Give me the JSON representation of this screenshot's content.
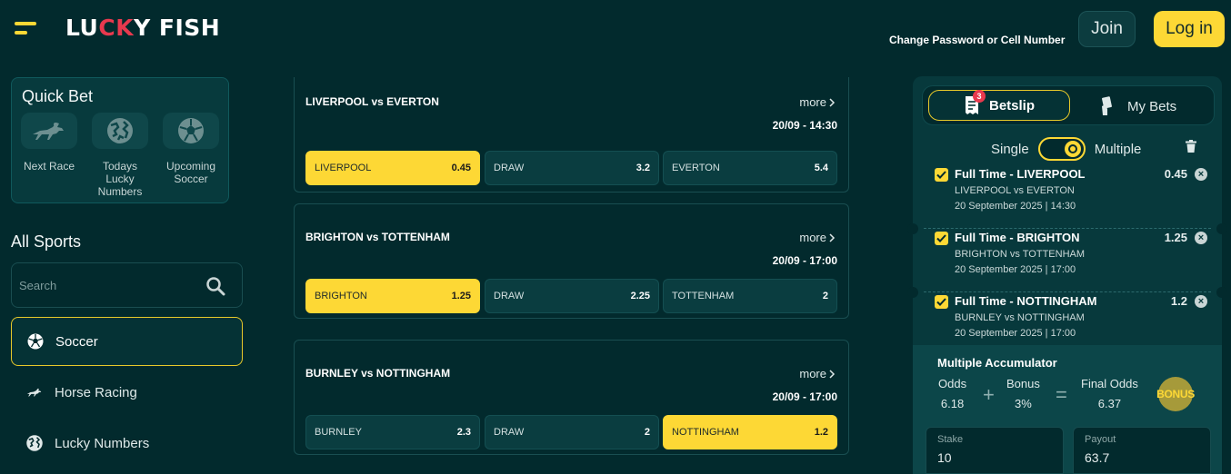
{
  "header": {
    "logo_text_a": "LU",
    "logo_text_b": "CK",
    "logo_text_c": "Y FISH",
    "change_password": "Change Password or Cell Number",
    "join": "Join",
    "login": "Log in"
  },
  "quick_bet": {
    "title": "Quick Bet",
    "items": [
      {
        "label": "Next Race",
        "icon": "horse-racing-icon"
      },
      {
        "label": "Todays Lucky Numbers",
        "icon": "globe-icon"
      },
      {
        "label": "Upcoming Soccer",
        "icon": "soccer-ball-icon"
      }
    ]
  },
  "sports": {
    "title": "All Sports",
    "search_placeholder": "Search",
    "items": [
      {
        "label": "Soccer",
        "icon": "soccer-ball-icon",
        "active": true
      },
      {
        "label": "Horse Racing",
        "icon": "horse-racing-icon"
      },
      {
        "label": "Lucky Numbers",
        "icon": "globe-icon"
      }
    ]
  },
  "matches": [
    {
      "title": "LIVERPOOL vs EVERTON",
      "more": "more",
      "datetime": "20/09 - 14:30",
      "odds": [
        {
          "label": "LIVERPOOL",
          "value": "0.45",
          "selected": true
        },
        {
          "label": "DRAW",
          "value": "3.2"
        },
        {
          "label": "EVERTON",
          "value": "5.4"
        }
      ]
    },
    {
      "title": "BRIGHTON vs TOTTENHAM",
      "more": "more",
      "datetime": "20/09 - 17:00",
      "odds": [
        {
          "label": "BRIGHTON",
          "value": "1.25",
          "selected": true
        },
        {
          "label": "DRAW",
          "value": "2.25"
        },
        {
          "label": "TOTTENHAM",
          "value": "2"
        }
      ]
    },
    {
      "title": "BURNLEY vs NOTTINGHAM",
      "more": "more",
      "datetime": "20/09 - 17:00",
      "odds": [
        {
          "label": "BURNLEY",
          "value": "2.3"
        },
        {
          "label": "DRAW",
          "value": "2"
        },
        {
          "label": "NOTTINGHAM",
          "value": "1.2",
          "selected": true
        }
      ]
    }
  ],
  "betslip": {
    "tab_betslip": "Betslip",
    "badge": "3",
    "tab_mybets": "My Bets",
    "single": "Single",
    "multiple": "Multiple",
    "bets": [
      {
        "title": "Full Time - LIVERPOOL",
        "match": "LIVERPOOL vs EVERTON",
        "date": "20 September 2025 | 14:30",
        "odd": "0.45"
      },
      {
        "title": "Full Time - BRIGHTON",
        "match": "BRIGHTON vs TOTTENHAM",
        "date": "20 September 2025 | 17:00",
        "odd": "1.25"
      },
      {
        "title": "Full Time - NOTTINGHAM",
        "match": "BURNLEY vs NOTTINGHAM",
        "date": "20 September 2025 | 17:00",
        "odd": "1.2"
      }
    ],
    "accumulator": {
      "title": "Multiple Accumulator",
      "odds_label": "Odds",
      "odds_value": "6.18",
      "bonus_label": "Bonus",
      "bonus_value": "3%",
      "final_label": "Final Odds",
      "final_value": "6.37",
      "bonus_badge": "BONUS",
      "plus": "+",
      "equals": "="
    },
    "stake_label": "Stake",
    "stake_value": "10",
    "payout_label": "Payout",
    "payout_value": "63.7"
  },
  "colors": {
    "background": "#022a2d",
    "accent": "#fdd835",
    "logo_red": "#e8394e"
  }
}
